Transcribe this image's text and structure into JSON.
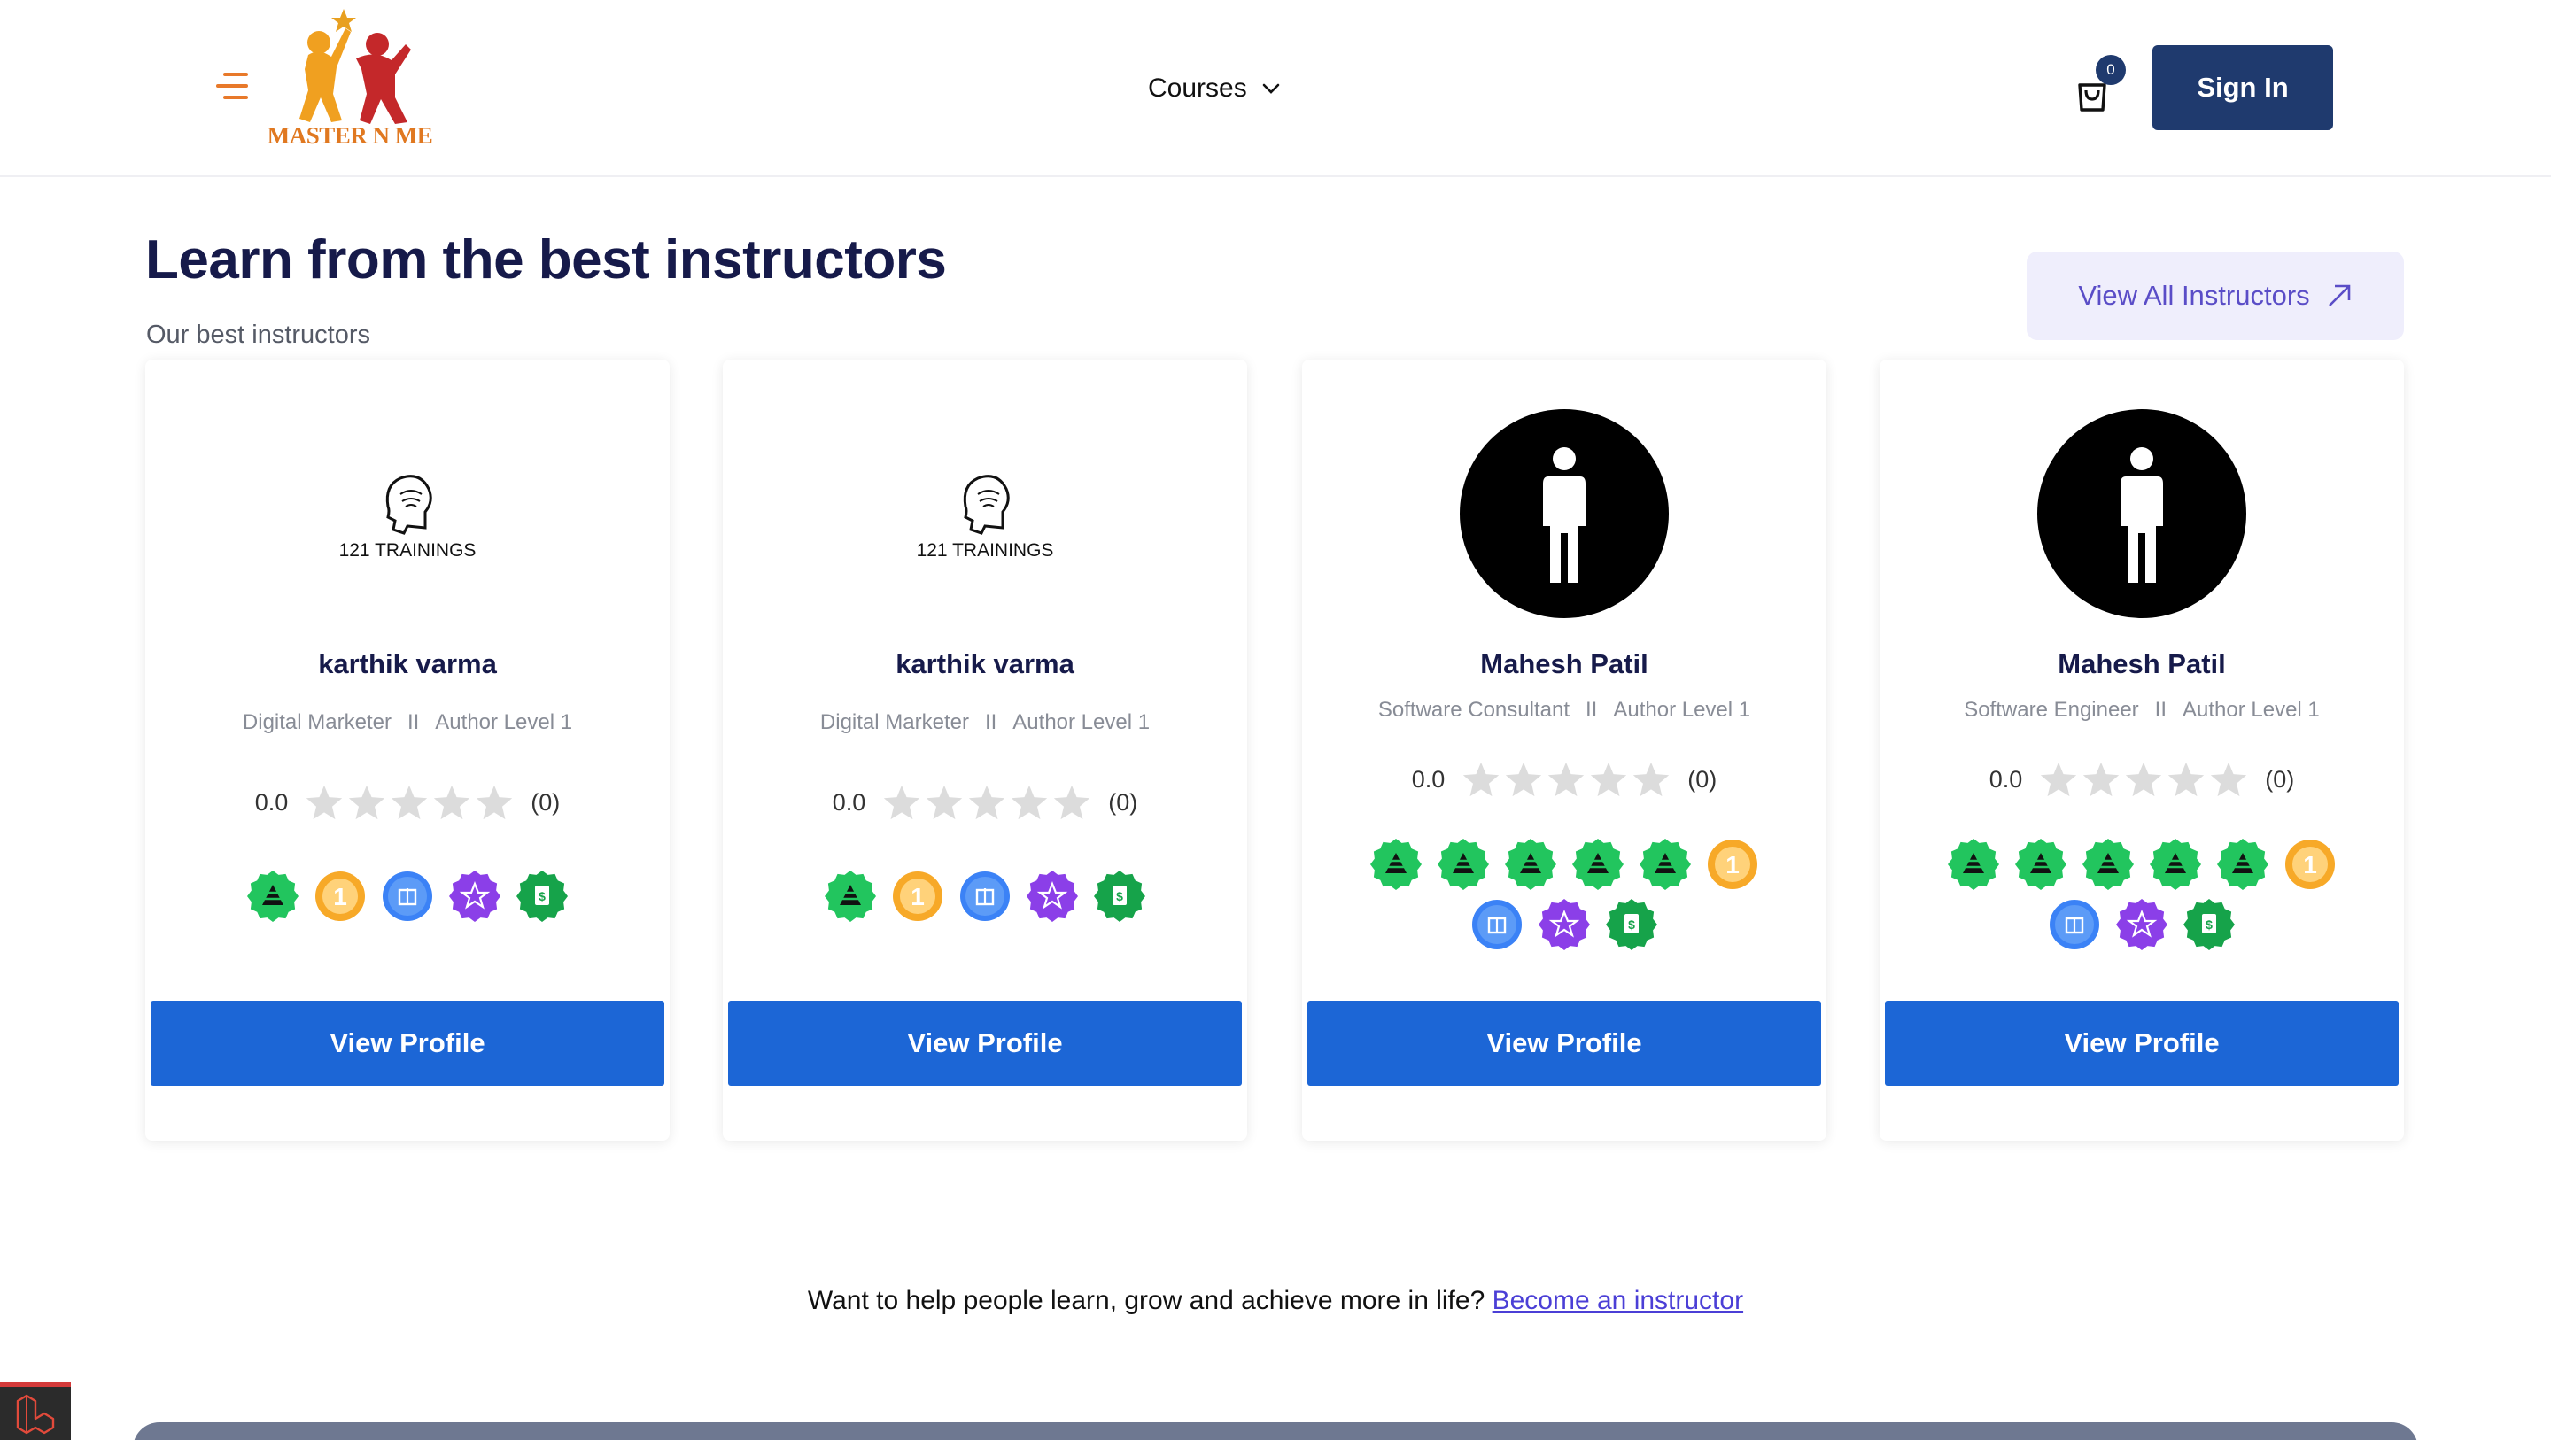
{
  "header": {
    "logo_text": "MASTER N ME",
    "courses_label": "Courses",
    "cart_count": "0",
    "signin_label": "Sign In"
  },
  "section": {
    "title": "Learn from the best instructors",
    "subtitle": "Our best instructors",
    "view_all_label": "View All Instructors"
  },
  "instructors": [
    {
      "name": "karthik varma",
      "avatar": "121-trainings-logo",
      "avatar_text": "121 TRAININGS",
      "role": "Digital Marketer",
      "separator": "II",
      "level": "Author Level 1",
      "rating": "0.0",
      "reviews": "(0)",
      "stars": 0,
      "badges": [
        "green-pyramid",
        "orange-number-one",
        "blue-gift",
        "purple-star",
        "green-certificate"
      ],
      "button": "View Profile"
    },
    {
      "name": "karthik varma",
      "avatar": "121-trainings-logo",
      "avatar_text": "121 TRAININGS",
      "role": "Digital Marketer",
      "separator": "II",
      "level": "Author Level 1",
      "rating": "0.0",
      "reviews": "(0)",
      "stars": 0,
      "badges": [
        "green-pyramid",
        "orange-number-one",
        "blue-gift",
        "purple-star",
        "green-certificate"
      ],
      "button": "View Profile"
    },
    {
      "name": "Mahesh Patil",
      "avatar": "person-silhouette",
      "role": "Software Consultant",
      "separator": "II",
      "level": "Author Level 1",
      "rating": "0.0",
      "reviews": "(0)",
      "stars": 0,
      "badges": [
        "green-pyramid",
        "green-pyramid",
        "green-pyramid",
        "green-pyramid",
        "green-pyramid",
        "orange-number-one",
        "blue-gift",
        "purple-star",
        "green-certificate"
      ],
      "button": "View Profile"
    },
    {
      "name": "Mahesh Patil",
      "avatar": "person-silhouette",
      "role": "Software Engineer",
      "separator": "II",
      "level": "Author Level 1",
      "rating": "0.0",
      "reviews": "(0)",
      "stars": 0,
      "badges": [
        "green-pyramid",
        "green-pyramid",
        "green-pyramid",
        "green-pyramid",
        "green-pyramid",
        "orange-number-one",
        "blue-gift",
        "purple-star",
        "green-certificate"
      ],
      "button": "View Profile"
    }
  ],
  "cta": {
    "text": "Want to help people learn, grow and achieve more in life?",
    "link": "Become an instructor"
  },
  "colors": {
    "primary_navy": "#1f3a6e",
    "button_blue": "#1c66d6",
    "title_navy": "#161a4a",
    "accent_purple": "#5a4dc7",
    "logo_orange": "#e07820"
  }
}
